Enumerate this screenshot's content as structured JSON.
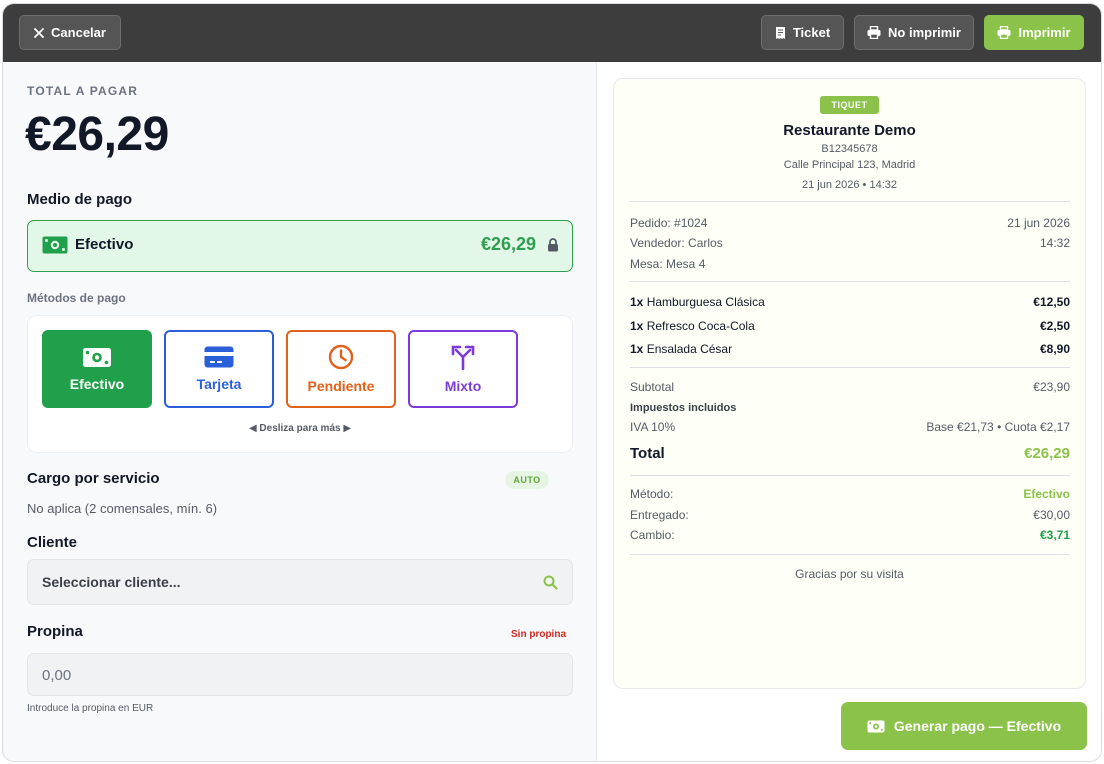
{
  "topbar": {
    "cancel_label": "Cancelar",
    "ticket_label": "Ticket",
    "no_print_label": "No imprimir",
    "print_label": "Imprimir"
  },
  "left": {
    "total_label": "TOTAL A PAGAR",
    "total_amount": "€26,29",
    "payment_medium_title": "Medio de pago",
    "selected_method": {
      "name": "Efectivo",
      "amount": "€26,29"
    },
    "methods_title": "Métodos de pago",
    "methods": [
      {
        "label": "Efectivo",
        "icon": "cash-icon",
        "color": "#20a04a",
        "active": true
      },
      {
        "label": "Tarjeta",
        "icon": "card-icon",
        "color": "#2b5fd9",
        "active": false
      },
      {
        "label": "Pendiente",
        "icon": "clock-icon",
        "color": "#e0611c",
        "active": false
      },
      {
        "label": "Mixto",
        "icon": "split-icon",
        "color": "#7c3bd9",
        "active": false
      }
    ],
    "swipe_hint": "◀ Desliza para más ▶",
    "service_charge_title": "Cargo por servicio",
    "service_charge_badge": "AUTO",
    "service_charge_note": "No aplica (2 comensales, mín. 6)",
    "client_title": "Cliente",
    "client_placeholder": "Seleccionar cliente...",
    "tip_title": "Propina",
    "tip_status": "Sin propina",
    "tip_value": "0,00",
    "tip_hint": "Introduce la propina en EUR"
  },
  "receipt": {
    "badge": "TIQUET",
    "restaurant": "Restaurante Demo",
    "tax_id": "B12345678",
    "address": "Calle Principal 123, Madrid",
    "datetime": "21 jun 2026 • 14:32",
    "order": "Pedido: #1024",
    "order_date": "21 jun 2026",
    "seller": "Vendedor: Carlos",
    "order_time": "14:32",
    "table": "Mesa: Mesa 4",
    "items": [
      {
        "qty": "1x",
        "name": "Hamburguesa Clásica",
        "price": "€12,50"
      },
      {
        "qty": "1x",
        "name": "Refresco Coca-Cola",
        "price": "€2,50"
      },
      {
        "qty": "1x",
        "name": "Ensalada César",
        "price": "€8,90"
      }
    ],
    "subtotal_label": "Subtotal",
    "subtotal": "€23,90",
    "taxes_label": "Impuestos incluidos",
    "iva_label": "IVA 10%",
    "iva_detail": "Base €21,73 • Cuota €2,17",
    "total_label": "Total",
    "total": "€26,29",
    "method_label": "Método:",
    "method": "Efectivo",
    "delivered_label": "Entregado:",
    "delivered": "€30,00",
    "change_label": "Cambio:",
    "change": "€3,71",
    "thanks": "Gracias por su visita"
  },
  "generate_button_label": "Generar pago — Efectivo",
  "colors": {
    "accent_green": "#8bc34a",
    "cash_green": "#20a04a",
    "topbar": "#3d3d3d",
    "danger": "#d0271f"
  }
}
